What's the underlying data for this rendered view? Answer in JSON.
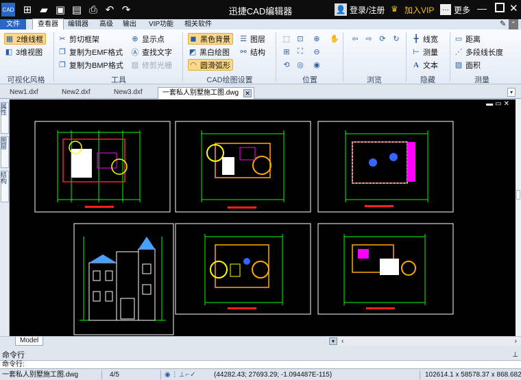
{
  "window": {
    "title": "迅捷CAD编辑器",
    "login": "登录/注册",
    "vip": "加入VIP",
    "more": "更多",
    "min": "—",
    "close": "✕"
  },
  "ribbon_tabs": [
    "文件",
    "查看器",
    "编辑器",
    "高级",
    "输出",
    "VIP功能",
    "相关软件"
  ],
  "ribbon": {
    "visual": {
      "items": [
        "2维线框",
        "3维视图"
      ],
      "label": "可视化风格"
    },
    "tools": {
      "items": [
        "剪切框架",
        "复制为EMF格式",
        "复制为BMP格式",
        "显示点",
        "查找文字",
        "修剪光栅"
      ],
      "label": "工具"
    },
    "cad_settings": {
      "items": [
        "黑色背景",
        "黑白绘图",
        "圆滑弧形",
        "图层",
        "结构"
      ],
      "label": "CAD绘图设置"
    },
    "position": {
      "label": "位置"
    },
    "browse": {
      "label": "浏览"
    },
    "hide": {
      "items": [
        "线宽",
        "测量",
        "文本"
      ],
      "label": "隐藏"
    },
    "measure": {
      "items": [
        "距离",
        "多段线长度",
        "面积"
      ],
      "label": "测量"
    }
  },
  "doc_tabs": [
    "New1.dxf",
    "New2.dxf",
    "New3.dxf",
    "一套私人别墅施工图.dwg"
  ],
  "left_panel": [
    "属性",
    "图层",
    "结构"
  ],
  "model_tab": "Model",
  "command": {
    "header": "命令行",
    "prompt": "命令行:"
  },
  "status": {
    "file": "一套私人别墅施工图.dwg",
    "page": "4/5",
    "coords": "(44282.43; 27693.29; -1.094487E-115)",
    "size": "102614.1 x 58578.37 x 868.6829"
  },
  "colors": {
    "accent": "#2a5da8",
    "canvas": "#000000",
    "highlight": "#ffd98a",
    "title_bar": "#0d0d0d"
  }
}
